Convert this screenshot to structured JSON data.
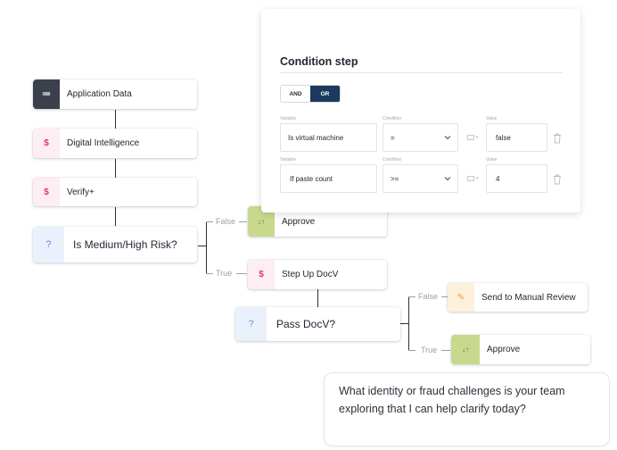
{
  "workflow": {
    "nodes": {
      "application_data": {
        "label": "Application Data",
        "icon": "list-icon",
        "glyph": "≔"
      },
      "digital_intelligence": {
        "label": "Digital Intelligence",
        "icon": "dollar-icon",
        "glyph": "$"
      },
      "verify_plus": {
        "label": "Verify+",
        "icon": "dollar-icon",
        "glyph": "$"
      },
      "is_medium_high_risk": {
        "label": "Is Medium/High Risk?",
        "icon": "question-icon",
        "glyph": "?"
      },
      "approve_1": {
        "label": "Approve",
        "icon": "sort-arrows-icon",
        "glyph": "↓↑"
      },
      "step_up_docv": {
        "label": "Step Up DocV",
        "icon": "dollar-icon",
        "glyph": "$"
      },
      "pass_docv": {
        "label": "Pass DocV?",
        "icon": "question-icon",
        "glyph": "?"
      },
      "send_manual_review": {
        "label": "Send to Manual Review",
        "icon": "pencil-icon",
        "glyph": "✎"
      },
      "approve_2": {
        "label": "Approve",
        "icon": "sort-arrows-icon",
        "glyph": "↓↑"
      }
    },
    "branches": {
      "false_1": "False",
      "true_1": "True",
      "false_2": "False",
      "true_2": "True"
    }
  },
  "condition_panel": {
    "title": "Condition step",
    "toggle": {
      "and": "AND",
      "or": "OR",
      "selected": "OR"
    },
    "rows": [
      {
        "variable_label": "Variable",
        "condition_label": "Condition",
        "value_label": "Value",
        "variable": "Is virtual machine",
        "condition": "=",
        "value": "false"
      },
      {
        "variable_label": "Variable",
        "condition_label": "Condition",
        "value_label": "Value",
        "variable": "If paste count",
        "condition": ">=",
        "value": "4"
      }
    ]
  },
  "chat": {
    "message": "What identity or fraud challenges is your team exploring that I can help clarify today?"
  },
  "colors": {
    "accent_dark": "#1b3a5c",
    "money_pink": "#e8336b",
    "question_blue": "#6a8fd4",
    "approve_green": "#c8d98e",
    "review_cream": "#fdf1dc"
  }
}
